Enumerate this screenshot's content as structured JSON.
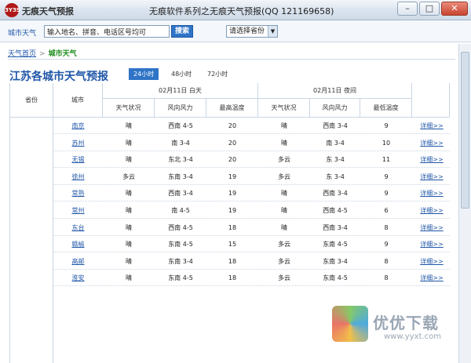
{
  "window": {
    "app_name": "无痕天气预报",
    "logo_text": "3Y3S",
    "title": "无痕软件系列之无痕天气预报(QQ 121169658)",
    "minimize": "–",
    "maximize": "□",
    "close": "✕"
  },
  "toolbar": {
    "city_label": "城市天气",
    "search_placeholder": "输入地名、拼音、电话区号均可",
    "search_button": "搜索",
    "province_select": "请选择省份",
    "select_arrow": "▼"
  },
  "breadcrumb": {
    "home": "天气首页",
    "separator": ">",
    "current": "城市天气"
  },
  "forecast": {
    "heading": "江苏各城市天气预报",
    "tabs": [
      "24小时",
      "48小时",
      "72小时"
    ],
    "active_tab": 0,
    "headers": {
      "province": "省份",
      "city": "城市",
      "day_group": "02月11日 白天",
      "night_group": "02月11日 夜间",
      "day_condition": "天气状况",
      "day_wind": "风向风力",
      "high_temp": "最高温度",
      "night_condition": "天气状况",
      "night_wind": "风向风力",
      "low_temp": "最低温度"
    },
    "detail_label": "详细>>",
    "rows": [
      {
        "city": "南京",
        "day_cond": "晴",
        "day_wind": "西南 4-5",
        "high": "20",
        "night_cond": "晴",
        "night_wind": "西南 3-4",
        "low": "9"
      },
      {
        "city": "苏州",
        "day_cond": "晴",
        "day_wind": "南 3-4",
        "high": "20",
        "night_cond": "晴",
        "night_wind": "南 3-4",
        "low": "10"
      },
      {
        "city": "无锡",
        "day_cond": "晴",
        "day_wind": "东北 3-4",
        "high": "20",
        "night_cond": "多云",
        "night_wind": "东 3-4",
        "low": "11"
      },
      {
        "city": "徐州",
        "day_cond": "多云",
        "day_wind": "东南 3-4",
        "high": "19",
        "night_cond": "多云",
        "night_wind": "东 3-4",
        "low": "9"
      },
      {
        "city": "常熟",
        "day_cond": "晴",
        "day_wind": "西南 3-4",
        "high": "19",
        "night_cond": "晴",
        "night_wind": "西南 3-4",
        "low": "9"
      },
      {
        "city": "常州",
        "day_cond": "晴",
        "day_wind": "南 4-5",
        "high": "19",
        "night_cond": "晴",
        "night_wind": "西南 4-5",
        "low": "6"
      },
      {
        "city": "东台",
        "day_cond": "晴",
        "day_wind": "西南 4-5",
        "high": "18",
        "night_cond": "晴",
        "night_wind": "西南 3-4",
        "low": "8"
      },
      {
        "city": "赣榆",
        "day_cond": "晴",
        "day_wind": "东南 4-5",
        "high": "15",
        "night_cond": "多云",
        "night_wind": "东南 4-5",
        "low": "9"
      },
      {
        "city": "高邮",
        "day_cond": "晴",
        "day_wind": "东南 3-4",
        "high": "18",
        "night_cond": "多云",
        "night_wind": "东南 3-4",
        "low": "8"
      },
      {
        "city": "淮安",
        "day_cond": "晴",
        "day_wind": "东南 4-5",
        "high": "18",
        "night_cond": "多云",
        "night_wind": "东南 4-5",
        "low": "8"
      }
    ]
  },
  "watermark": {
    "text": "优优下载",
    "url": "www.yyxt.com"
  }
}
